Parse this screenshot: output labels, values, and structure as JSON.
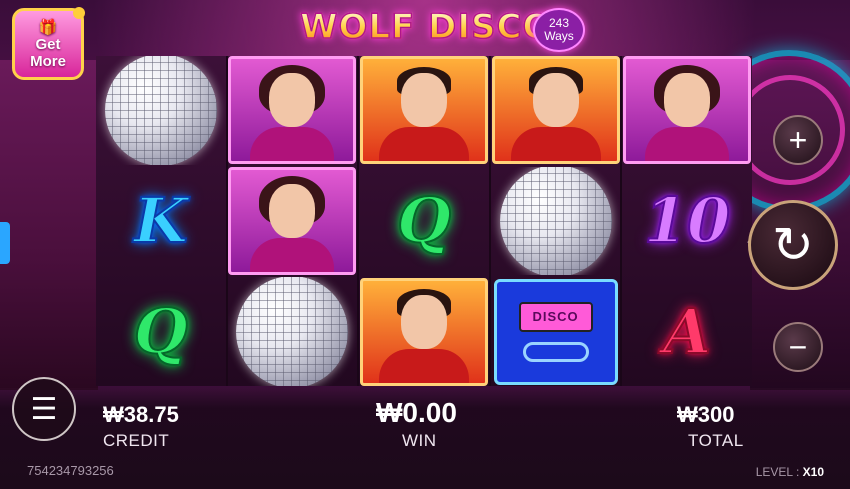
{
  "game": {
    "title": "WOLF DISCO",
    "ways_count": "243",
    "ways_label": "Ways"
  },
  "promo": {
    "get_more_line1": "Get",
    "get_more_line2": "More"
  },
  "reels": [
    [
      {
        "type": "disco-ball"
      },
      {
        "type": "letter",
        "value": "K",
        "style": "k"
      },
      {
        "type": "letter",
        "value": "Q",
        "style": "q"
      }
    ],
    [
      {
        "type": "woman"
      },
      {
        "type": "woman"
      },
      {
        "type": "disco-ball"
      }
    ],
    [
      {
        "type": "man"
      },
      {
        "type": "letter",
        "value": "Q",
        "style": "q"
      },
      {
        "type": "man"
      }
    ],
    [
      {
        "type": "man"
      },
      {
        "type": "disco-ball"
      },
      {
        "type": "disco-pager",
        "value": "DISCO"
      }
    ],
    [
      {
        "type": "woman"
      },
      {
        "type": "letter",
        "value": "10",
        "style": "ten"
      },
      {
        "type": "letter",
        "value": "A",
        "style": "a"
      }
    ]
  ],
  "controls": {
    "plus_symbol": "+",
    "minus_symbol": "−",
    "spin_symbol": "↻",
    "menu_symbol": "☰",
    "chevron": "‹"
  },
  "stats": {
    "credit_value": "₩38.75",
    "credit_label": "CREDIT",
    "win_value": "₩0.00",
    "win_label": "WIN",
    "total_value": "₩300",
    "total_label": "TOTAL"
  },
  "footer": {
    "session_id": "754234793256",
    "level_label": "LEVEL : ",
    "level_value": "X10"
  },
  "icons": {
    "plus": "plus-icon",
    "minus": "minus-icon",
    "spin": "spin-icon",
    "menu": "menu-icon",
    "gift": "gift-icon"
  },
  "colors": {
    "k_symbol": "#3ad0ff",
    "q_symbol": "#2fe86a",
    "ten_symbol": "#d87cff",
    "a_symbol": "#ff3a6a",
    "gold_border": "#ffd24a"
  }
}
